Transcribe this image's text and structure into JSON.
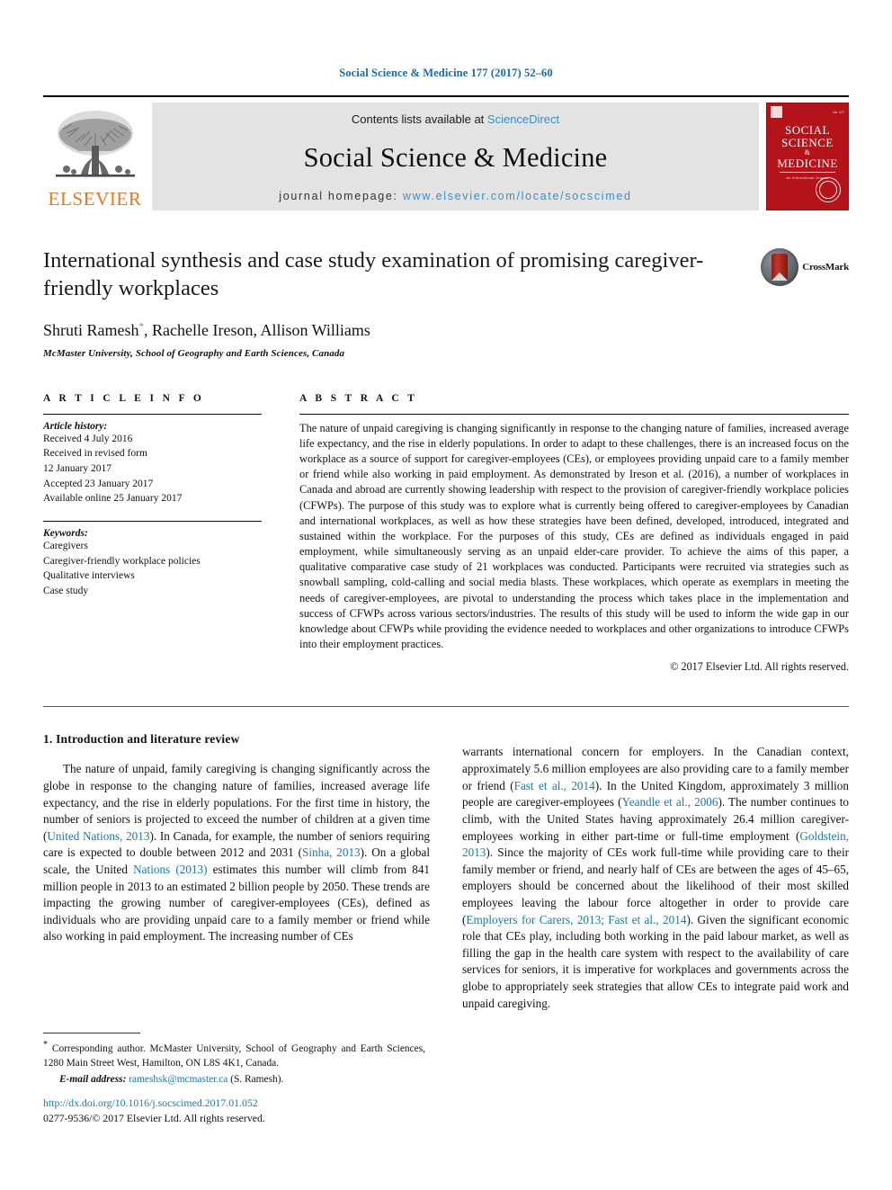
{
  "running_head": "Social Science & Medicine 177 (2017) 52–60",
  "journal_header": {
    "publisher_logo_label": "ELSEVIER",
    "contents_prefix": "Contents lists available at ",
    "contents_link": "ScienceDirect",
    "journal_name": "Social Science & Medicine",
    "homepage_prefix": "journal homepage: ",
    "homepage_url": "www.elsevier.com/locate/socscimed",
    "cover": {
      "line1": "SOCIAL",
      "line2": "SCIENCE",
      "line3": "&",
      "line4": "MEDICINE",
      "issue_label": "Vol. 177",
      "subtitle": "An International Journal"
    }
  },
  "article": {
    "title": "International synthesis and case study examination of promising caregiver-friendly workplaces",
    "authors": "Shruti Ramesh, Rachelle Ireson, Allison Williams",
    "author_marker": "*",
    "affiliation": "McMaster University, School of Geography and Earth Sciences, Canada",
    "crossmark_label": "CrossMark"
  },
  "article_info": {
    "section_label": "A R T I C L E   I N F O",
    "history_label": "Article history:",
    "history": [
      "Received 4 July 2016",
      "Received in revised form",
      "12 January 2017",
      "Accepted 23 January 2017",
      "Available online 25 January 2017"
    ],
    "keywords_label": "Keywords:",
    "keywords": [
      "Caregivers",
      "Caregiver-friendly workplace policies",
      "Qualitative interviews",
      "Case study"
    ]
  },
  "abstract": {
    "section_label": "A B S T R A C T",
    "text": "The nature of unpaid caregiving is changing significantly in response to the changing nature of families, increased average life expectancy, and the rise in elderly populations. In order to adapt to these challenges, there is an increased focus on the workplace as a source of support for caregiver-employees (CEs), or employees providing unpaid care to a family member or friend while also working in paid employment. As demonstrated by Ireson et al. (2016), a number of workplaces in Canada and abroad are currently showing leadership with respect to the provision of caregiver-friendly workplace policies (CFWPs). The purpose of this study was to explore what is currently being offered to caregiver-employees by Canadian and international workplaces, as well as how these strategies have been defined, developed, introduced, integrated and sustained within the workplace. For the purposes of this study, CEs are defined as individuals engaged in paid employment, while simultaneously serving as an unpaid elder-care provider. To achieve the aims of this paper, a qualitative comparative case study of 21 workplaces was conducted. Participants were recruited via strategies such as snowball sampling, cold-calling and social media blasts. These workplaces, which operate as exemplars in meeting the needs of caregiver-employees, are pivotal to understanding the process which takes place in the implementation and success of CFWPs across various sectors/industries. The results of this study will be used to inform the wide gap in our knowledge about CFWPs while providing the evidence needed to workplaces and other organizations to introduce CFWPs into their employment practices.",
    "copyright": "© 2017 Elsevier Ltd. All rights reserved."
  },
  "body": {
    "section_heading": "1. Introduction and literature review",
    "left_column_parts": [
      {
        "type": "text",
        "value": "The nature of unpaid, family caregiving is changing significantly across the globe in response to the changing nature of families, increased average life expectancy, and the rise in elderly populations. For the first time in history, the number of seniors is projected to exceed the number of children at a given time ("
      },
      {
        "type": "ref",
        "value": "United Nations, 2013"
      },
      {
        "type": "text",
        "value": "). In Canada, for example, the number of seniors requiring care is expected to double between 2012 and 2031 ("
      },
      {
        "type": "ref",
        "value": "Sinha, 2013"
      },
      {
        "type": "text",
        "value": "). On a global scale, the United "
      },
      {
        "type": "ref",
        "value": "Nations (2013)"
      },
      {
        "type": "text",
        "value": " estimates this number will climb from 841 million people in 2013 to an estimated 2 billion people by 2050. These trends are impacting the growing number of caregiver-employees (CEs), defined as individuals who are providing unpaid care to a family member or friend while also working in paid employment. The increasing number of CEs"
      }
    ],
    "right_column_parts": [
      {
        "type": "text",
        "value": "warrants international concern for employers. In the Canadian context, approximately 5.6 million employees are also providing care to a family member or friend ("
      },
      {
        "type": "ref",
        "value": "Fast et al., 2014"
      },
      {
        "type": "text",
        "value": "). In the United Kingdom, approximately 3 million people are caregiver-employees ("
      },
      {
        "type": "ref",
        "value": "Yeandle et al., 2006"
      },
      {
        "type": "text",
        "value": "). The number continues to climb, with the United States having approximately 26.4 million caregiver-employees working in either part-time or full-time employment ("
      },
      {
        "type": "ref",
        "value": "Goldstein, 2013"
      },
      {
        "type": "text",
        "value": "). Since the majority of CEs work full-time while providing care to their family member or friend, and nearly half of CEs are between the ages of 45–65, employers should be concerned about the likelihood of their most skilled employees leaving the labour force altogether in order to provide care ("
      },
      {
        "type": "ref",
        "value": "Employers for Carers, 2013; Fast et al., 2014"
      },
      {
        "type": "text",
        "value": "). Given the significant economic role that CEs play, including both working in the paid labour market, as well as filling the gap in the health care system with respect to the availability of care services for seniors, it is imperative for workplaces and governments across the globe to appropriately seek strategies that allow CEs to integrate paid work and unpaid caregiving."
      }
    ]
  },
  "footnotes": {
    "corresponding_marker": "*",
    "corresponding_text": " Corresponding author. McMaster University, School of Geography and Earth Sciences, 1280 Main Street West, Hamilton, ON L8S 4K1, Canada.",
    "email_label": "E-mail address:",
    "email_address": "rameshsk@mcmaster.ca",
    "email_owner": "(S. Ramesh)."
  },
  "footer": {
    "doi_url": "http://dx.doi.org/10.1016/j.socscimed.2017.01.052",
    "issn_line": "0277-9536/© 2017 Elsevier Ltd. All rights reserved."
  },
  "colors": {
    "link": "#1a7aad",
    "header_blue": "#1a6ca8",
    "elsevier_orange": "#e87722",
    "cover_red": "#b5131a",
    "band_gray": "#e3e3e3"
  }
}
